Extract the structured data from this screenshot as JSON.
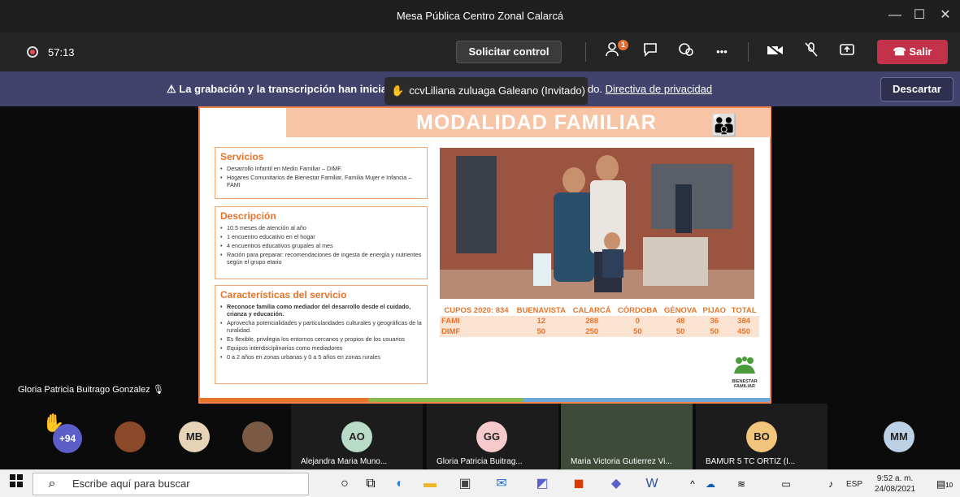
{
  "window": {
    "title": "Mesa Pública Centro Zonal Calarcá",
    "minimize": "—",
    "maximize": "☐",
    "close": "✕"
  },
  "toolbar": {
    "timer": "57:13",
    "request_control": "Solicitar control",
    "participants_badge": "1",
    "more": "•••",
    "leave": "Salir"
  },
  "banner": {
    "message": "La grabación y la transcripción han inicia",
    "message_tail": "ido.",
    "privacy_link": "Directiva de privacidad",
    "discard": "Descartar"
  },
  "raised_hand_tip": "ccvLiliana zuluaga Galeano (Invitado)",
  "slide": {
    "title": "MODALIDAD FAMILIAR",
    "servicios": {
      "heading": "Servicios",
      "items": [
        "Desarrollo Infantil en Medio Familiar – DIMF.",
        "Hogares Comunitarios de Bienestar Familiar, Familia Mujer e Infancia – FAMI"
      ]
    },
    "descripcion": {
      "heading": "Descripción",
      "items": [
        "10.5 meses de atención al año",
        "1 encuentro educativo en el hogar",
        "4 encuentros educativos grupales al mes",
        "Ración para preparar: recomendaciones de ingesta de energía y nutrientes según el grupo etario"
      ]
    },
    "caracteristicas": {
      "heading": "Características del servicio",
      "items": [
        "Reconoce familia como mediador del desarrollo desde el cuidado, crianza y educación.",
        "Aprovecha potencialidades y particularidades culturales y geográficas de la ruralidad.",
        "Es flexible, privilegia los entornos cercanos y propios de los usuarios",
        "Equipos interdisciplinarios como mediadores",
        "0 a 2 años en zonas urbanas y 0 a 5 años en zonas rurales"
      ]
    },
    "cupos": {
      "header": [
        "CUPOS 2020: 834",
        "BUENAVISTA",
        "CALARCÁ",
        "CÓRDOBA",
        "GÉNOVA",
        "PIJAO",
        "TOTAL"
      ],
      "rows": [
        [
          "FAMI",
          "12",
          "288",
          "0",
          "48",
          "36",
          "384"
        ],
        [
          "DIMF",
          "50",
          "250",
          "50",
          "50",
          "50",
          "450"
        ]
      ]
    },
    "logo_text": "BIENESTAR FAMILIAR"
  },
  "speaker_name": "Gloria Patricia Buitrago Gonzalez",
  "participants": {
    "overflow": "+94",
    "tiles": [
      {
        "initials": "MB",
        "color": "#e6d3b8"
      },
      {
        "initials": "AO",
        "color": "#b9dcc9",
        "name": "Alejandra Maria Muno..."
      },
      {
        "initials": "GG",
        "color": "#f6c9cd",
        "name": "Gloria Patricia Buitrag..."
      },
      {
        "name": "Maria Victoria Gutierrez Vi..."
      },
      {
        "initials": "BO",
        "color": "#f3c47c",
        "name": "BAMUR 5 TC ORTIZ (I..."
      },
      {
        "initials": "MM",
        "color": "#bcd0e6"
      }
    ]
  },
  "taskbar": {
    "search_placeholder": "Escribe aquí para buscar",
    "language": "ESP",
    "time": "9:52 a. m.",
    "date": "24/08/2021",
    "notifications": "10"
  }
}
